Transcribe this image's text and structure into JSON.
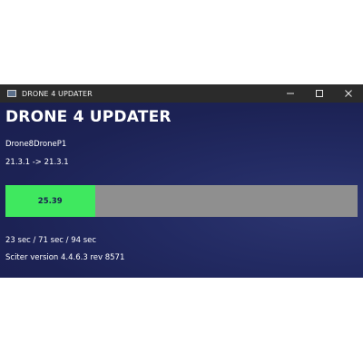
{
  "window": {
    "title": "DRONE 4 UPDATER",
    "icon": "app-window-icon",
    "controls": [
      "minimize-icon",
      "maximize-icon",
      "close-icon"
    ]
  },
  "main": {
    "heading": "DRONE 4 UPDATER",
    "device_name": "Drone8DroneP1",
    "version_change": "21.3.1 -> 21.3.1",
    "progress": {
      "value": 25.39,
      "label": "25.39",
      "fill_color": "#3fe85f",
      "track_color": "#8f8f8f"
    },
    "times": "23 sec / 71 sec / 94 sec",
    "sciter_version": "Sciter version 4.4.6.3 rev 8571"
  },
  "colors": {
    "background": "#1e2456",
    "titlebar": "#2b2b2b",
    "text": "#ffffff"
  }
}
